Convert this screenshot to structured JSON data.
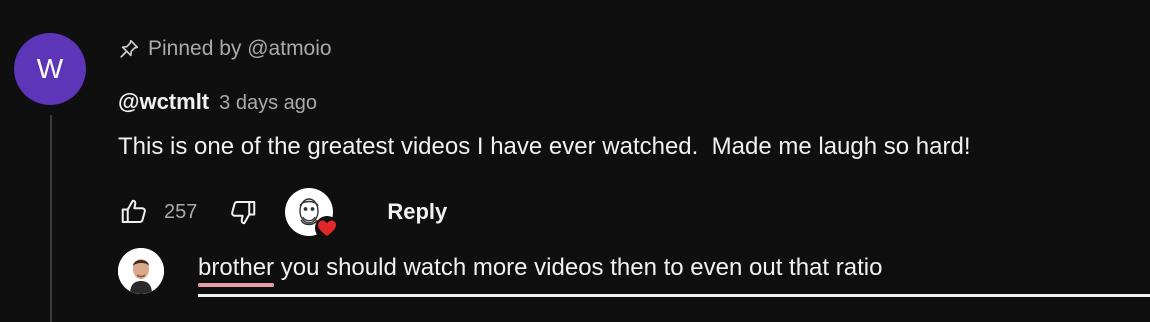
{
  "comment": {
    "avatar_letter": "W",
    "avatar_color": "#5c35b8",
    "pinned_text": "Pinned by @atmoio",
    "author": "@wctmlt",
    "time": "3 days ago",
    "text": "This is one of the greatest videos I have ever watched.  Made me laugh so hard!",
    "like_count": "257",
    "reply_label": "Reply",
    "heart_color": "#e02828"
  },
  "reply_box": {
    "misspelled_word": "brother",
    "rest_text": " you should watch more videos then to even out that ratio",
    "misspell_color": "#e8a0a8"
  },
  "icons": [
    "pin-icon",
    "thumbs-up-icon",
    "thumbs-down-icon",
    "creator-heart-icon"
  ]
}
